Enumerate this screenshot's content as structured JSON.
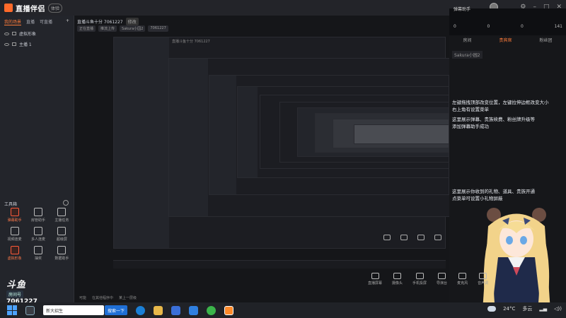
{
  "app": {
    "name": "直播伴侣",
    "badge": "体验"
  },
  "left_sidebar": {
    "tabs": [
      "我的场景",
      "直播",
      "可直播"
    ],
    "scenes": [
      "虚拟形象",
      "主播 1"
    ],
    "tools_title": "工具箱",
    "tools": [
      {
        "label": "弹幕助手",
        "hot": true
      },
      {
        "label": "房管助手",
        "hot": false
      },
      {
        "label": "主播任务",
        "hot": false
      },
      {
        "label": "视频连麦",
        "hot": false
      },
      {
        "label": "多人连麦",
        "hot": false
      },
      {
        "label": "超级屏",
        "hot": false
      },
      {
        "label": "虚拟形象",
        "hot": true
      },
      {
        "label": "抽奖",
        "hot": false
      },
      {
        "label": "数据助手",
        "hot": false
      }
    ]
  },
  "main": {
    "room_title": "直播斗鱼十分 7061227",
    "room_chip": "修改",
    "room_meta": [
      "正在直播",
      "推流上传",
      "Sakura小园2",
      "7061227"
    ]
  },
  "watermark": {
    "mark": "斗鱼",
    "tag": "房间号",
    "room_number": "7061227"
  },
  "danmu": {
    "title": "弹幕助手",
    "stats": [
      "0",
      "0",
      "0",
      "141"
    ],
    "tabs": [
      "房间",
      "贵宾席",
      "粉丝团"
    ],
    "user": "Sakura小园2",
    "help1": "左键拖拽顶部改变位置，左键拉伸边框改变大小",
    "help1b": "右上角有设置菜单",
    "help2": "这里展示弹幕、贵族续费、粉丝牌升级等",
    "help2b": "添加弹幕助手成功",
    "help3": "这里展示你收到的礼物、道具、贵族开通",
    "help3b": "点菜单可设置小礼物屏蔽"
  },
  "bottom_tools": [
    "直播屏幕",
    "摄像头",
    "手机投屏",
    "导演台",
    "麦克风",
    "音声调"
  ],
  "ticker": [
    "可能",
    "在其他程序中",
    "某上一层级"
  ],
  "taskbar": {
    "search_placeholder": "新大招生",
    "search_button": "搜索一下",
    "temp": "24°C",
    "weather": "多云"
  },
  "colors": {
    "accent": "#ff7c3a",
    "taskbar": "#202227",
    "start_blue": "#4da3ff"
  }
}
